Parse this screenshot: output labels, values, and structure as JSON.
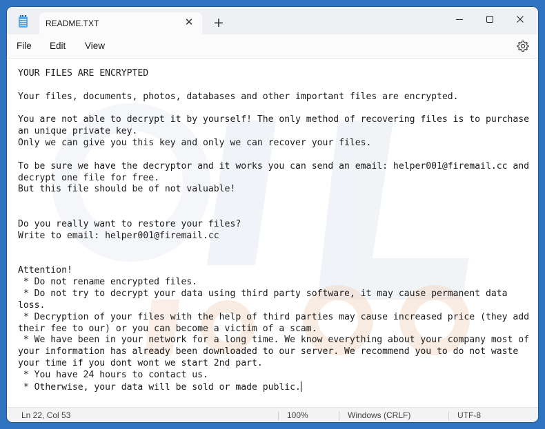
{
  "window": {
    "tab_title": "README.TXT"
  },
  "menu": {
    "items": [
      "File",
      "Edit",
      "View"
    ]
  },
  "document": {
    "lines": [
      "YOUR FILES ARE ENCRYPTED",
      "",
      "Your files, documents, photos, databases and other important files are encrypted.",
      "",
      "You are not able to decrypt it by yourself! The only method of recovering files is to purchase",
      "an unique private key.",
      "Only we can give you this key and only we can recover your files.",
      "",
      "To be sure we have the decryptor and it works you can send an email: helper001@firemail.cc and",
      "decrypt one file for free.",
      "But this file should be of not valuable!",
      "",
      "",
      "Do you really want to restore your files?",
      "Write to email: helper001@firemail.cc",
      "",
      "",
      "Attention!",
      " * Do not rename encrypted files.",
      " * Do not try to decrypt your data using third party software, it may cause permanent data",
      "loss.",
      " * Decryption of your files with the help of third parties may cause increased price (they add",
      "their fee to our) or you can become a victim of a scam.",
      " * We have been in your network for a long time. We know everything about your company most of",
      "your information has already been downloaded to our server. We recommend you to do not waste",
      "your time if you dont wont we start 2nd part.",
      " * You have 24 hours to contact us.",
      " * Otherwise, your data will be sold or made public."
    ]
  },
  "status": {
    "position": "Ln 22, Col 53",
    "zoom": "100%",
    "line_ending": "Windows (CRLF)",
    "encoding": "UTF-8"
  },
  "watermark": {
    "text": "pcrisk.com",
    "logo_text": "PCL"
  }
}
